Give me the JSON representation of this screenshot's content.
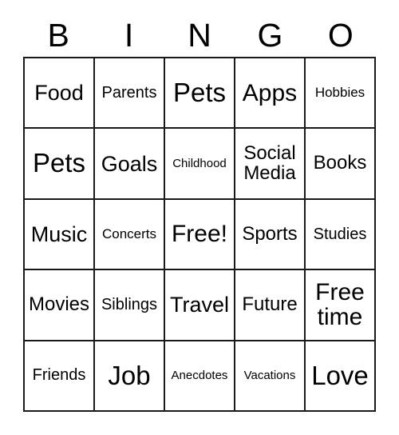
{
  "card": {
    "title": "BINGO",
    "header_letters": [
      "B",
      "I",
      "N",
      "G",
      "O"
    ],
    "columns": 5,
    "rows": 5,
    "free_space": "Free!",
    "free_space_position": "center",
    "colors": {
      "background": "#ffffff",
      "text": "#000000",
      "grid_line": "#1a1a1a"
    },
    "cells": [
      {
        "label": "Food",
        "size": "lg"
      },
      {
        "label": "Parents",
        "size": "sm"
      },
      {
        "label": "Pets",
        "size": "xxl"
      },
      {
        "label": "Apps",
        "size": "xl"
      },
      {
        "label": "Hobbies",
        "size": "xs"
      },
      {
        "label": "Pets",
        "size": "xxl"
      },
      {
        "label": "Goals",
        "size": "lg"
      },
      {
        "label": "Childhood",
        "size": "xxs"
      },
      {
        "label": "Social Media",
        "size": "md"
      },
      {
        "label": "Books",
        "size": "md"
      },
      {
        "label": "Music",
        "size": "lg"
      },
      {
        "label": "Concerts",
        "size": "xs"
      },
      {
        "label": "Free!",
        "size": "xl"
      },
      {
        "label": "Sports",
        "size": "md"
      },
      {
        "label": "Studies",
        "size": "sm"
      },
      {
        "label": "Movies",
        "size": "md"
      },
      {
        "label": "Siblings",
        "size": "sm"
      },
      {
        "label": "Travel",
        "size": "lg"
      },
      {
        "label": "Future",
        "size": "md"
      },
      {
        "label": "Free time",
        "size": "xl"
      },
      {
        "label": "Friends",
        "size": "sm"
      },
      {
        "label": "Job",
        "size": "xxl"
      },
      {
        "label": "Anecdotes",
        "size": "xxs"
      },
      {
        "label": "Vacations",
        "size": "xxs"
      },
      {
        "label": "Love",
        "size": "xxl"
      }
    ]
  }
}
